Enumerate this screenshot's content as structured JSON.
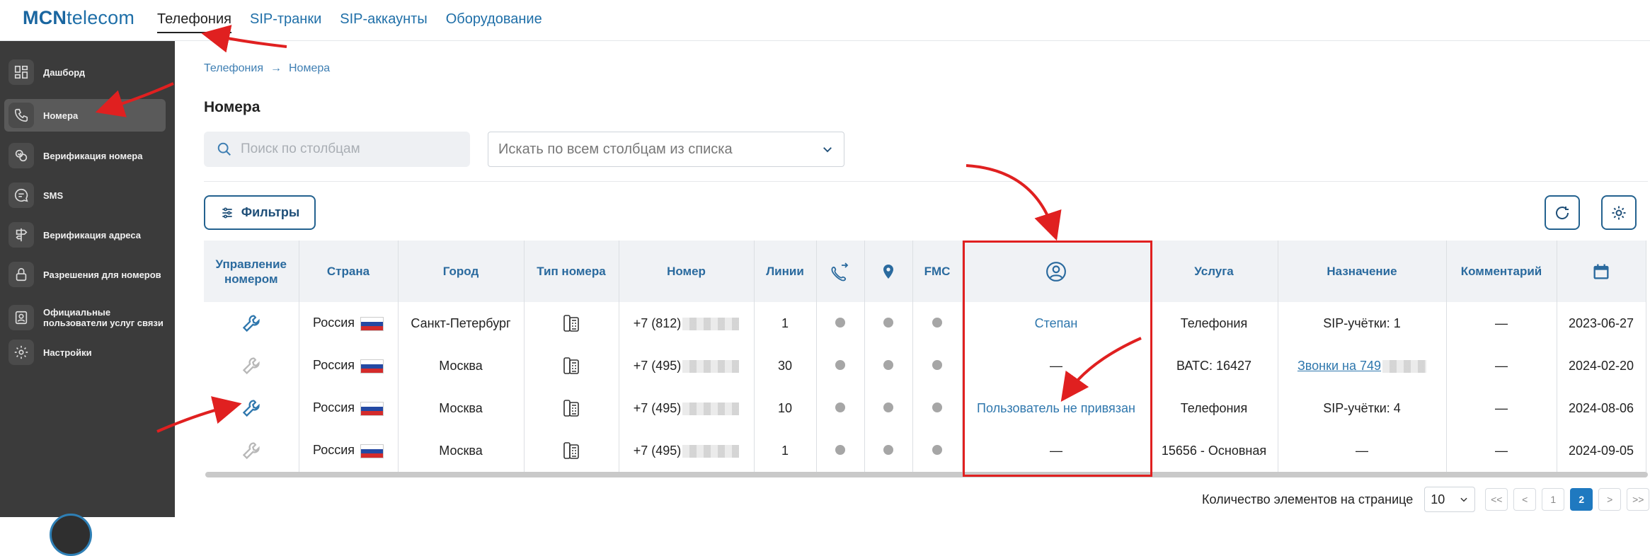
{
  "header": {
    "logo_bold": "MCN",
    "logo_rest": "telecom",
    "nav": [
      {
        "label": "Телефония",
        "active": true
      },
      {
        "label": "SIP-транки",
        "active": false
      },
      {
        "label": "SIP-аккаунты",
        "active": false
      },
      {
        "label": "Оборудование",
        "active": false
      }
    ]
  },
  "sidebar": {
    "items": [
      {
        "label": "Дашборд",
        "icon": "dashboard-icon",
        "active": false
      },
      {
        "label": "Номера",
        "icon": "phone-icon",
        "active": true
      },
      {
        "label": "Верификация номера",
        "icon": "verification-icon",
        "active": false
      },
      {
        "label": "SMS",
        "icon": "sms-icon",
        "active": false
      },
      {
        "label": "Верификация адреса",
        "icon": "address-sign-icon",
        "active": false
      },
      {
        "label": "Разрешения для номеров",
        "icon": "lock-icon",
        "active": false
      },
      {
        "label": "Официальные пользователи услуг связи",
        "icon": "user-document-icon",
        "active": false
      },
      {
        "label": "Настройки",
        "icon": "gear-icon",
        "active": false
      }
    ]
  },
  "breadcrumb": {
    "root": "Телефония",
    "current": "Номера"
  },
  "page_title": "Номера",
  "search": {
    "placeholder": "Поиск по столбцам",
    "value": ""
  },
  "column_select": {
    "placeholder": "Искать по всем столбцам из списка"
  },
  "toolbar": {
    "filters_label": "Фильтры"
  },
  "table": {
    "headers": {
      "manage": "Управление номером",
      "country": "Страна",
      "city": "Город",
      "number_type": "Тип номера",
      "number": "Номер",
      "lines": "Линии",
      "fmc": "FMC",
      "service": "Услуга",
      "assignment": "Назначение",
      "comment": "Комментарий"
    },
    "rows": [
      {
        "manage_active": true,
        "country": "Россия",
        "city": "Санкт-Петербург",
        "number": "+7 (812)",
        "lines": "1",
        "user": "Степан",
        "user_link": true,
        "service": "Телефония",
        "assignment": "SIP-учётки: 1",
        "assignment_link": false,
        "comment": "—",
        "date": "2023-06-27"
      },
      {
        "manage_active": false,
        "country": "Россия",
        "city": "Москва",
        "number": "+7 (495)",
        "lines": "30",
        "user": "—",
        "user_link": false,
        "service": "ВАТС: 16427",
        "assignment": "Звонки на 749",
        "assignment_link": true,
        "comment": "—",
        "date": "2024-02-20"
      },
      {
        "manage_active": true,
        "country": "Россия",
        "city": "Москва",
        "number": "+7 (495)",
        "lines": "10",
        "user": "Пользователь не привязан",
        "user_link": true,
        "service": "Телефония",
        "assignment": "SIP-учётки: 4",
        "assignment_link": false,
        "comment": "—",
        "date": "2024-08-06"
      },
      {
        "manage_active": false,
        "country": "Россия",
        "city": "Москва",
        "number": "+7 (495)",
        "lines": "1",
        "user": "—",
        "user_link": false,
        "service": "15656 - Основная",
        "assignment": "—",
        "assignment_link": false,
        "comment": "—",
        "date": "2024-09-05"
      }
    ]
  },
  "pagination": {
    "label": "Количество элементов на странице",
    "page_size": "10",
    "first": "<<",
    "prev": "<",
    "pages": [
      "1",
      "2"
    ],
    "current_page": "2",
    "next": ">",
    "last": ">>"
  },
  "colors": {
    "accent": "#1f79c0",
    "sidebar_bg": "#3b3b3b",
    "annotation": "#e02020"
  }
}
